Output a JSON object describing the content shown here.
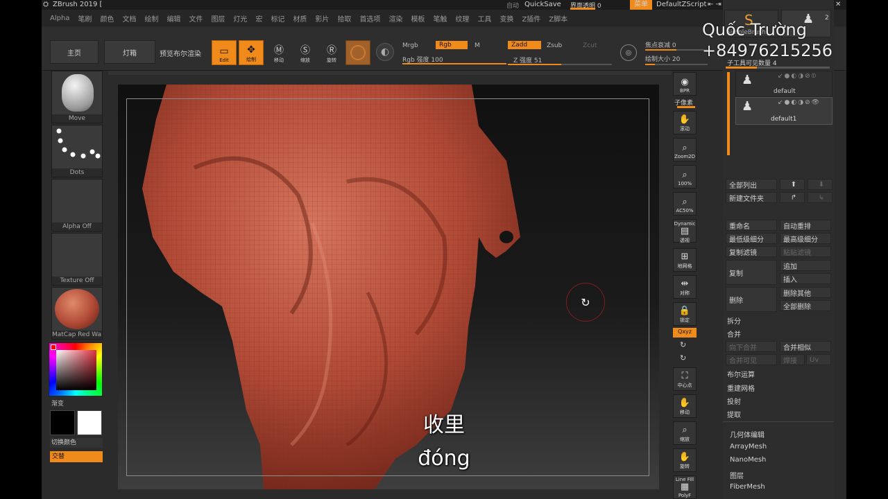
{
  "titlebar": {
    "app_title": "ZBrush 2019 [",
    "auto_label": "自动",
    "quicksave": "QuickSave",
    "transparency": "界面透明 0",
    "menu_btn": "菜单",
    "script": "DefaultZScript"
  },
  "menubar": [
    "Alpha",
    "笔刷",
    "颜色",
    "文档",
    "绘制",
    "编辑",
    "文件",
    "图层",
    "灯光",
    "宏",
    "标记",
    "材质",
    "影片",
    "拾取",
    "首选项",
    "渲染",
    "模板",
    "笔触",
    "纹理",
    "工具",
    "变换",
    "Z插件",
    "Z脚本"
  ],
  "shelf": {
    "home": "主页",
    "lightbox": "灯箱",
    "preview_bpr": "预览布尔渲染",
    "edit": "Edit",
    "draw": "绘制",
    "move": "移动",
    "scale": "缩放",
    "rotate": "旋转",
    "mrgb": "Mrgb",
    "rgb": "Rgb",
    "m": "M",
    "rgb_intensity": "Rgb 强度 100",
    "zadd": "Zadd",
    "zsub": "Zsub",
    "zcut": "Zcut",
    "z_intensity": "Z 强度 51",
    "focal_shift": "焦点衰减 0",
    "draw_size": "绘制大小 20"
  },
  "left": {
    "brush": "Move",
    "stroke": "Dots",
    "alpha": "Alpha Off",
    "texture": "Texture Off",
    "material": "MatCap Red Wa",
    "gradient": "渐变",
    "switch_color": "切换颜色",
    "alternate": "交替"
  },
  "righttools": {
    "bpr": "BPR",
    "subpixel": "子像素",
    "scroll": "滚动",
    "zoom2d": "Zoom2D",
    "p100": "100%",
    "ac50": "AC50%",
    "dynamic": "Dynamic",
    "persp": "透视",
    "floor": "地网格",
    "local": "对称",
    "lock": "锁定",
    "xyz": "Qxyz",
    "frame": "中心点",
    "move": "移动",
    "zoom": "缩放",
    "rotate": "旋转",
    "linefill": "Line Fill",
    "polyf": "PolyF"
  },
  "rightpanel": {
    "brush_count": "2",
    "brush_label": "SimpleBrush",
    "subtool_visible": "子工具可见数量 4",
    "subtools": [
      "default",
      "default1"
    ],
    "list_all": "全部列出",
    "new_folder": "新建文件夹",
    "rename": "重命名",
    "autoreorder": "自动重排",
    "lowest": "最低级细分",
    "highest": "最高级细分",
    "copy": "复制滤镜",
    "paste": "粘贴滤镜",
    "duplicate": "复制",
    "append": "追加",
    "insert": "插入",
    "delete": "删除",
    "del_other": "删除其他",
    "del_all": "全部删除",
    "split": "拆分",
    "merge": "合并",
    "merge_down": "向下合并",
    "merge_similar": "合并相似",
    "merge_visible": "合并可见",
    "weld": "焊接",
    "uv": "Uv",
    "boolean": "布尔运算",
    "remesh": "重建网格",
    "project": "投射",
    "extract": "提取",
    "list": [
      "几何体编辑",
      "ArrayMesh",
      "NanoMesh",
      "图层",
      "FiberMesh"
    ]
  },
  "watermark": {
    "name": "Quốc Trường",
    "phone": "+84976215256"
  },
  "subtitle": {
    "zh": "收里",
    "vi": "đóng"
  },
  "colors": {
    "accent": "#f08a1a",
    "clay": "#b04a36"
  }
}
